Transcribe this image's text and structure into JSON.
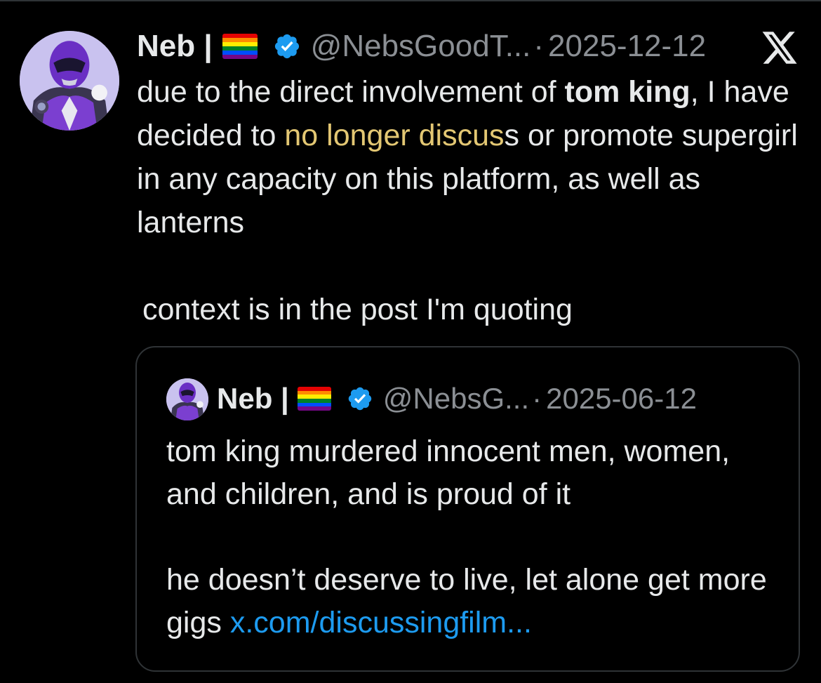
{
  "colors": {
    "background": "#000000",
    "text": "#e7e9ea",
    "muted": "#8b8f94",
    "link": "#1d9bf0",
    "highlight": "#e3c773",
    "verified": "#1d9bf0",
    "border": "#2f3336"
  },
  "post": {
    "author_name": "Neb |",
    "handle": "@NebsGoodT...",
    "separator": "·",
    "date": "2025-12-12",
    "verified_icon": "verified-badge-icon",
    "flag_icon": "rainbow-flag-icon",
    "platform_icon": "x-logo-icon",
    "text": {
      "p1": "due to the direct involvement of ",
      "bold": "tom king",
      "p2": ", I have decided to ",
      "highlighted": "no longer discus",
      "p3": "s or promote supergirl in any capacity on this platform, as well as lanterns",
      "context": "context is in the post I'm quoting"
    }
  },
  "quoted_post": {
    "author_name": "Neb |",
    "handle": "@NebsG...",
    "separator": "·",
    "date": "2025-06-12",
    "line1": "tom king murdered innocent men, women, and children, and is proud of it",
    "line2": "he doesn’t deserve to live, let alone get more gigs ",
    "link_text": "x.com/discussingfilm..."
  }
}
